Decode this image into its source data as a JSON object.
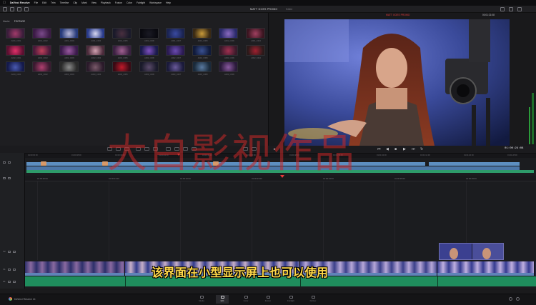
{
  "menubar": {
    "app_name": "DaVinci Resolve",
    "items": [
      "File",
      "Edit",
      "Trim",
      "Timeline",
      "Clip",
      "Mark",
      "View",
      "Playback",
      "Fusion",
      "Color",
      "Fairlight",
      "Workspace",
      "Help"
    ]
  },
  "header": {
    "project_title": "MATT GOES PROMO",
    "edited_label": "Edited"
  },
  "media_pool": {
    "bin_items": [
      "Master",
      "FOOTAGE"
    ],
    "clips": [
      {
        "label": "A001_C001",
        "c1": "#3a1d3a",
        "c2": "#a03a6a"
      },
      {
        "label": "A001_C002",
        "c1": "#3b1a45",
        "c2": "#7a4a8a"
      },
      {
        "label": "A001_C003",
        "c1": "#263a7a",
        "c2": "#b8b8d8"
      },
      {
        "label": "A001_C004",
        "c1": "#283a8a",
        "c2": "#d8d8f0"
      },
      {
        "label": "A001_C005",
        "c1": "#1a1a2a",
        "c2": "#4a3040"
      },
      {
        "label": "A001_C006",
        "c1": "#0a0a10",
        "c2": "#1a1a24"
      },
      {
        "label": "A001_C007",
        "c1": "#1a2350",
        "c2": "#3a4aa0"
      },
      {
        "label": "A001_C008",
        "c1": "#3a2a14",
        "c2": "#c89a3a"
      },
      {
        "label": "A001_C009",
        "c1": "#2a2a6a",
        "c2": "#8a6ac0"
      },
      {
        "label": "A001_C010",
        "c1": "#3a1520",
        "c2": "#a04060"
      },
      {
        "label": "A002_C001",
        "c1": "#5a1030",
        "c2": "#e0306a"
      },
      {
        "label": "A002_C002",
        "c1": "#4a1a3a",
        "c2": "#c0405a"
      },
      {
        "label": "A002_C003",
        "c1": "#3a1a4a",
        "c2": "#9a5aa0"
      },
      {
        "label": "A002_C004",
        "c1": "#4a2a3a",
        "c2": "#d0a0b0"
      },
      {
        "label": "A002_C005",
        "c1": "#3a2040",
        "c2": "#a06090"
      },
      {
        "label": "A002_C006",
        "c1": "#1a1a4a",
        "c2": "#8050c0"
      },
      {
        "label": "A002_C007",
        "c1": "#2a1a50",
        "c2": "#6a4ab0"
      },
      {
        "label": "A002_C008",
        "c1": "#101a3a",
        "c2": "#3a5090"
      },
      {
        "label": "A002_C009",
        "c1": "#3a1a2a",
        "c2": "#a03050"
      },
      {
        "label": "A002_C010",
        "c1": "#2a1a1a",
        "c2": "#a02030"
      },
      {
        "label": "A003_C001",
        "c1": "#141a4a",
        "c2": "#4a5ab0"
      },
      {
        "label": "A003_C002",
        "c1": "#3a1a30",
        "c2": "#b04070"
      },
      {
        "label": "A003_C003",
        "c1": "#2a2a2a",
        "c2": "#8a8a8a"
      },
      {
        "label": "A003_C004",
        "c1": "#2a1a2a",
        "c2": "#7a5a6a"
      },
      {
        "label": "A003_C005",
        "c1": "#3a0a14",
        "c2": "#c01a2a"
      },
      {
        "label": "A003_C006",
        "c1": "#1a1a2a",
        "c2": "#5a4a6a"
      },
      {
        "label": "A003_C007",
        "c1": "#1a1a3a",
        "c2": "#6a5a9a"
      },
      {
        "label": "A003_C008",
        "c1": "#1a2a3a",
        "c2": "#5a7aa0"
      },
      {
        "label": "A003_C009",
        "c1": "#2a1a3a",
        "c2": "#8a5aa0"
      }
    ]
  },
  "viewer": {
    "label": "MATT GOES PROMO",
    "timecode_top": "00:01:21:08",
    "timecode_main": "01:00:24:08"
  },
  "timeline": {
    "mini_ticks": [
      "01:00:00:00",
      "01:00:08:00",
      "01:00:16:00",
      "01:00:24:00",
      "01:00:32:00",
      "01:00:40:00",
      "01:00:48:00",
      "01:00:56:00",
      "01:01:04:00",
      "01:01:12:00",
      "01:01:20:00",
      "01:01:28:00"
    ],
    "main_ticks": [
      "01:00:20:00",
      "01:00:21:00",
      "01:00:22:00",
      "01:00:23:00",
      "01:00:24:00",
      "01:00:25:00",
      "01:00:26:00",
      "01:00:27:00"
    ],
    "track_labels": {
      "v2": "V2",
      "v1": "V1",
      "a1": "A1"
    }
  },
  "subtitle": "该界面在小型显示屏上也可以使用",
  "watermark": "大白影视作品",
  "bottom": {
    "brand": "DaVinci Resolve 14",
    "pages": [
      "Media",
      "Edit",
      "Color",
      "Fusion",
      "Fairlight",
      "Deliver"
    ],
    "active_page": "Edit"
  }
}
